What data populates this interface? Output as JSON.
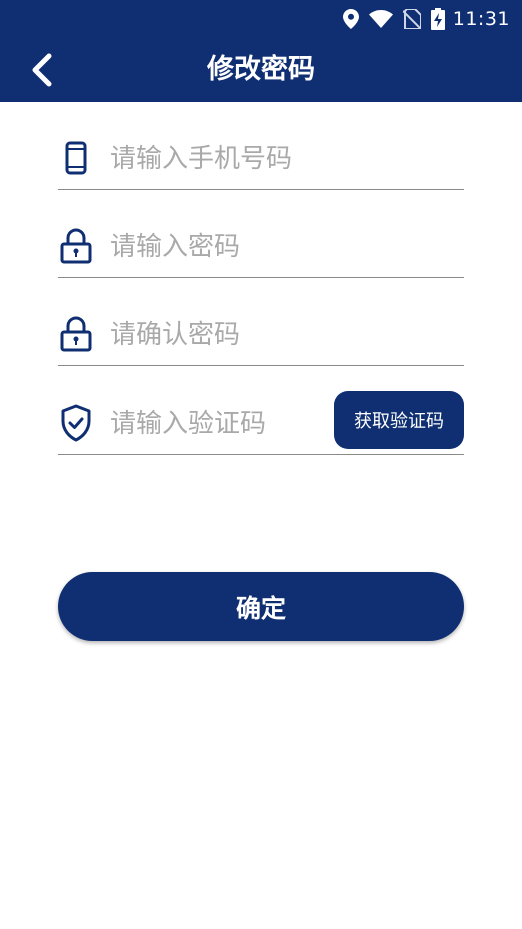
{
  "status_bar": {
    "time": "11:31",
    "icons": [
      "location-icon",
      "wifi-icon",
      "no-sim-icon",
      "battery-charging-icon"
    ]
  },
  "header": {
    "title": "修改密码",
    "back_icon": "chevron-left-icon"
  },
  "form": {
    "phone": {
      "placeholder": "请输入手机号码",
      "value": "",
      "icon": "phone-icon"
    },
    "password": {
      "placeholder": "请输入密码",
      "value": "",
      "icon": "lock-icon"
    },
    "confirm_password": {
      "placeholder": "请确认密码",
      "value": "",
      "icon": "lock-icon"
    },
    "code": {
      "placeholder": "请输入验证码",
      "value": "",
      "icon": "shield-check-icon"
    },
    "get_code_label": "获取验证码"
  },
  "confirm_label": "确定",
  "colors": {
    "primary": "#0f2f72",
    "background": "#ffffff",
    "placeholder": "#a9a9a9",
    "divider": "#8a8a8a"
  }
}
